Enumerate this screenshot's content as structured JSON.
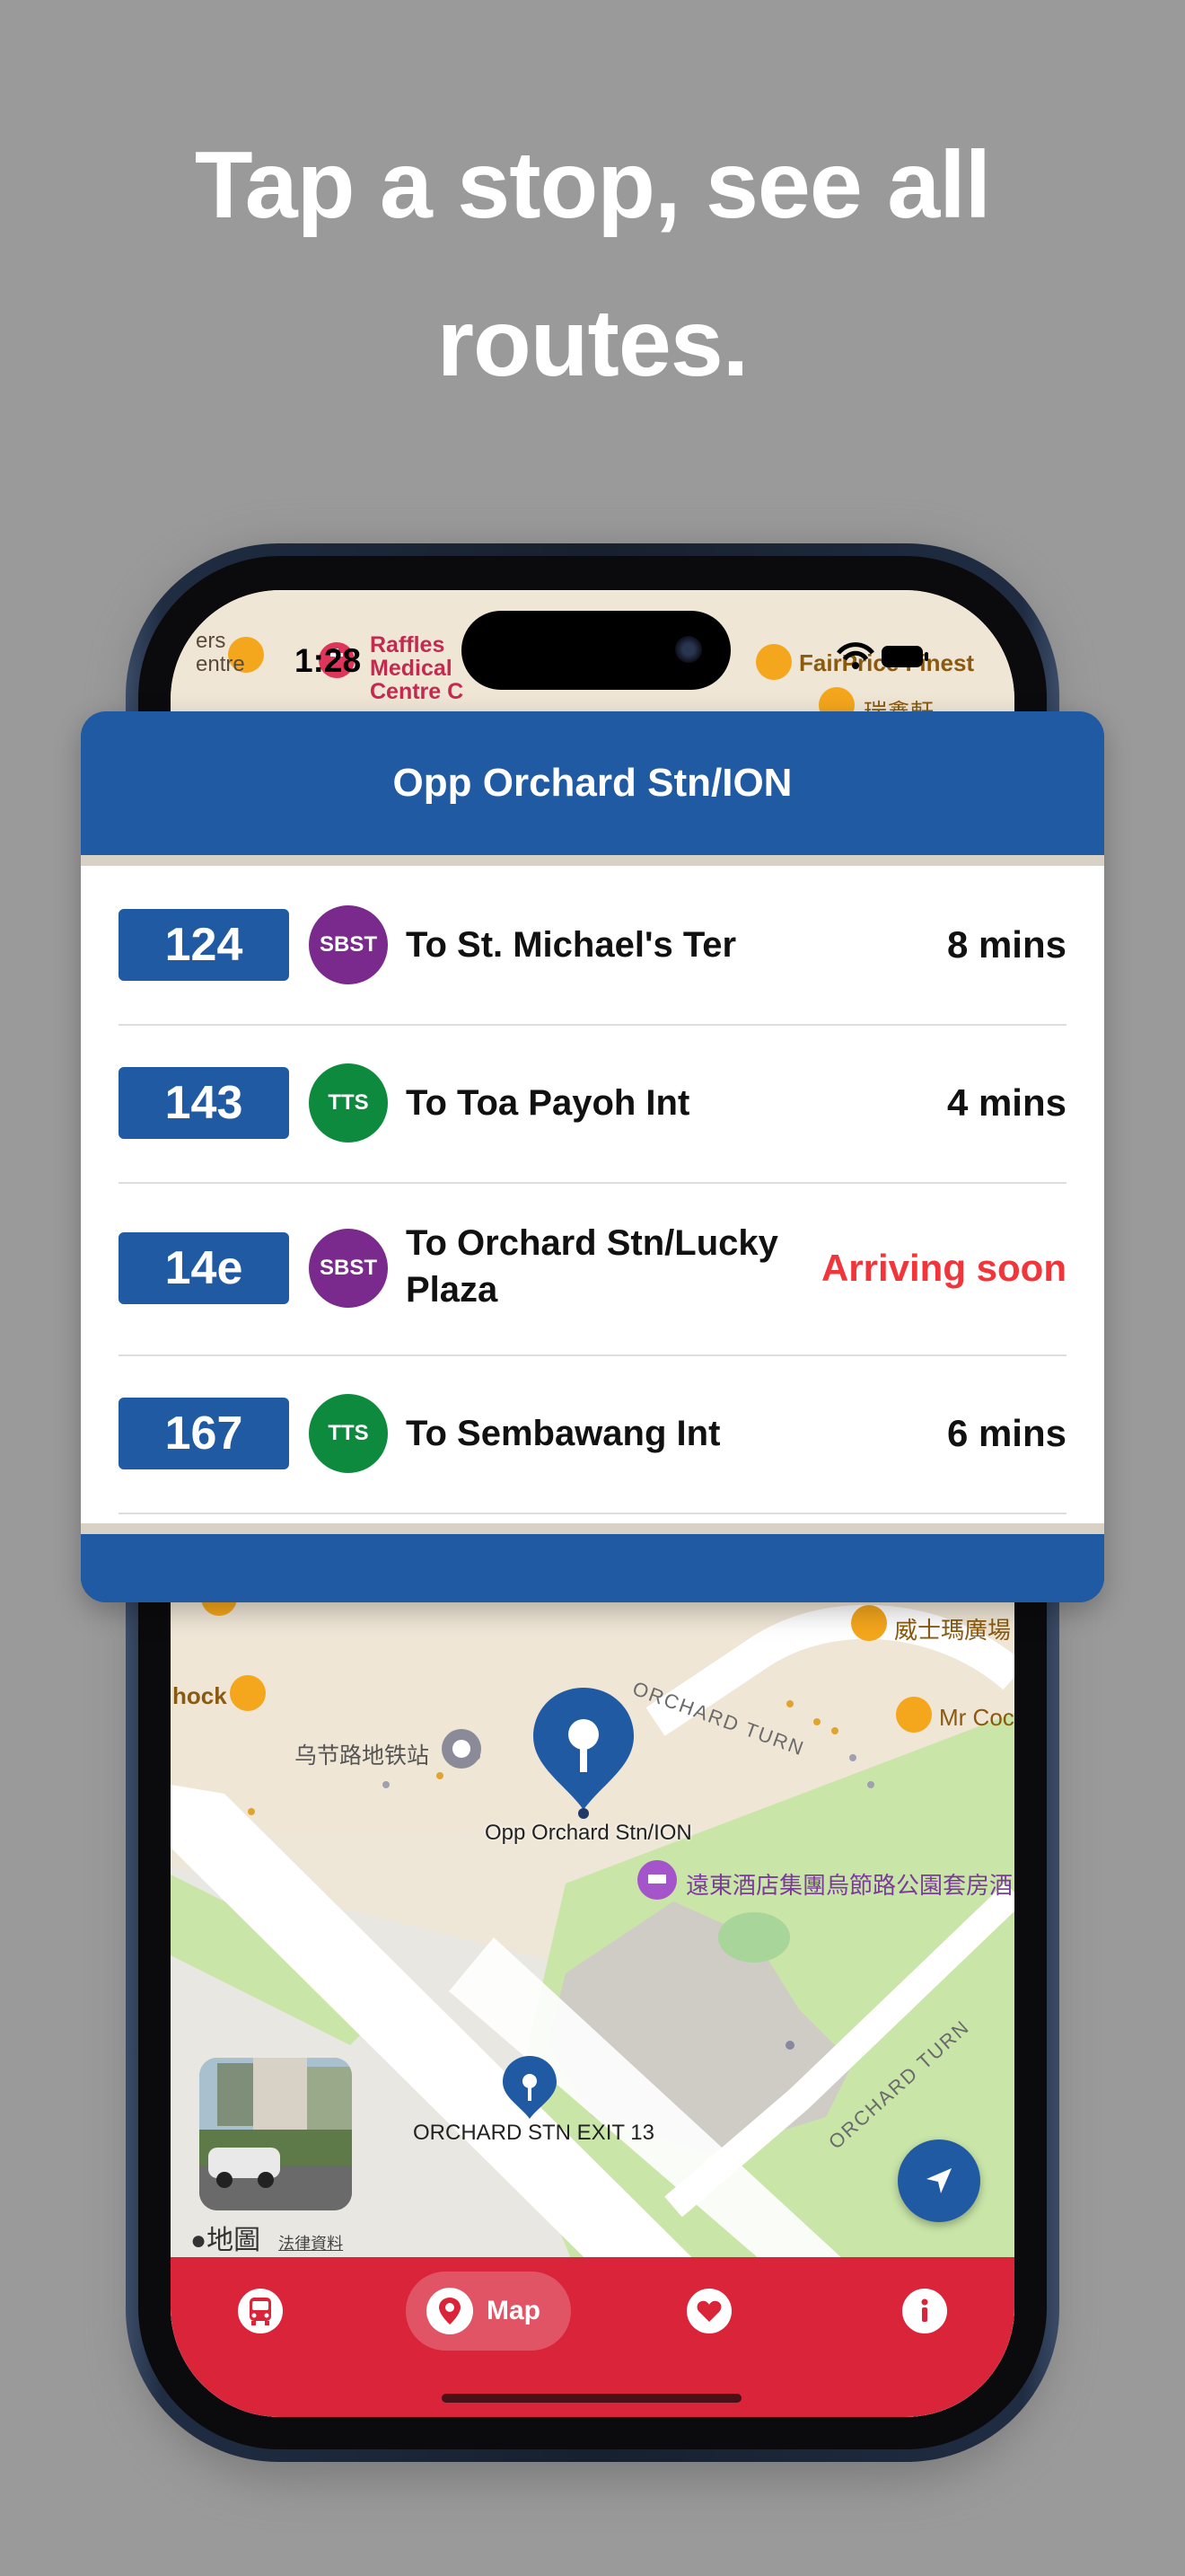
{
  "headline": {
    "line1": "Tap a stop, see all",
    "line2": "routes."
  },
  "status_bar": {
    "time": "1:28"
  },
  "map": {
    "labels": {
      "raffles": "Raffles\nMedical\nCentre C",
      "top_left": "ers\nentre",
      "fairprice": "FairPrice Finest",
      "top_right_cjk": "瑞鑫軒",
      "wisma": "威士瑪廣場",
      "mr_coconut": "Mr Coc",
      "shock": "hock",
      "orchard_mrt": "乌节路地铁站",
      "orchard_turn_top": "ORCHARD TURN",
      "orchard_turn_right": "ORCHARD TURN",
      "hotel": "遠東酒店集團烏節路公園套房酒",
      "stop_label": "Opp Orchard Stn/ION",
      "exit_label": "ORCHARD STN EXIT 13",
      "attribution": "地圖",
      "legal": "法律資料"
    }
  },
  "stop_card": {
    "title": "Opp Orchard Stn/ION",
    "arrivals": [
      {
        "route": "124",
        "operator": "SBST",
        "destination": "To St. Michael's Ter",
        "eta": "8 mins"
      },
      {
        "route": "143",
        "operator": "TTS",
        "destination": "To Toa Payoh Int",
        "eta": "4 mins"
      },
      {
        "route": "14e",
        "operator": "SBST",
        "destination": "To Orchard Stn/Lucky Plaza",
        "eta": "Arriving soon"
      },
      {
        "route": "167",
        "operator": "TTS",
        "destination": "To Sembawang Int",
        "eta": "6 mins"
      }
    ]
  },
  "tab_bar": {
    "tabs": [
      {
        "icon": "bus-icon",
        "label": ""
      },
      {
        "icon": "map-pin-icon",
        "label": "Map"
      },
      {
        "icon": "heart-icon",
        "label": ""
      },
      {
        "icon": "info-icon",
        "label": ""
      }
    ]
  },
  "colors": {
    "brand_blue": "#1f5aa3",
    "tab_red": "#d9243a",
    "sbst": "#7a2a8c",
    "tts": "#0e8a3e",
    "arriving": "#f0363b"
  }
}
